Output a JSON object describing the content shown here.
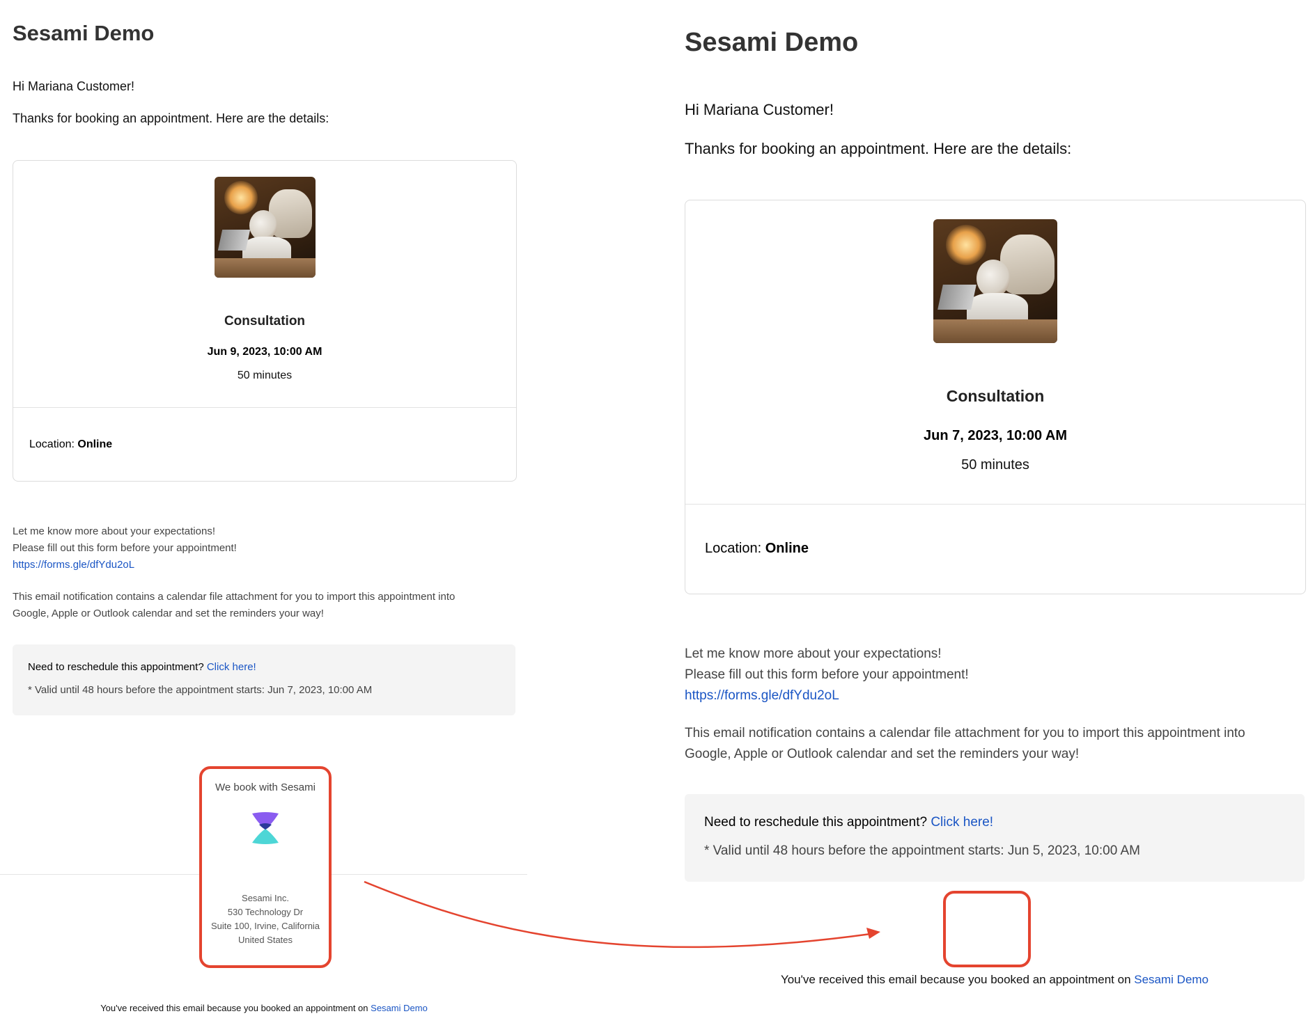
{
  "left": {
    "brand": "Sesami Demo",
    "greeting": "Hi Mariana Customer!",
    "intro": "Thanks for booking an appointment. Here are the details:",
    "service": "Consultation",
    "datetime": "Jun 9, 2023, 10:00 AM",
    "duration": "50 minutes",
    "location_label": "Location:",
    "location_value": "Online",
    "note_line1": "Let me know more about your expectations!",
    "note_line2": "Please fill out this form before your appointment!",
    "form_link": "https://forms.gle/dfYdu2oL",
    "calendar_line1": "This email notification contains a calendar file attachment for you to import this appointment into",
    "calendar_line2": "Google, Apple or Outlook calendar and set the reminders your way!",
    "reschedule_question": "Need to reschedule this appointment?",
    "reschedule_link": "Click here!",
    "reschedule_valid": "* Valid until 48 hours before the appointment starts: Jun 7, 2023, 10:00 AM",
    "badge_text": "We book with Sesami",
    "address": [
      "Sesami Inc.",
      "530 Technology Dr",
      "Suite 100, Irvine, California",
      "United States"
    ],
    "footer_text": "You've received this email because you booked an appointment on",
    "footer_link": "Sesami Demo"
  },
  "right": {
    "brand": "Sesami Demo",
    "greeting": "Hi Mariana Customer!",
    "intro": "Thanks for booking an appointment. Here are the details:",
    "service": "Consultation",
    "datetime": "Jun 7, 2023, 10:00 AM",
    "duration": "50 minutes",
    "location_label": "Location:",
    "location_value": "Online",
    "note_line1": "Let me know more about your expectations!",
    "note_line2": "Please fill out this form before your appointment!",
    "form_link": "https://forms.gle/dfYdu2oL",
    "calendar_line1": "This email notification contains a calendar file attachment for you to import this appointment into",
    "calendar_line2": "Google, Apple or Outlook calendar and set the reminders your way!",
    "reschedule_question": "Need to reschedule this appointment?",
    "reschedule_link": "Click here!",
    "reschedule_valid": "* Valid until 48 hours before the appointment starts: Jun 5, 2023, 10:00 AM",
    "footer_text": "You've received this email because you booked an appointment on",
    "footer_link": "Sesami Demo"
  },
  "colors": {
    "highlight": "#e4442f",
    "link": "#1a55c4",
    "logo_top": "#8a5cf0",
    "logo_bottom": "#4dd6d6"
  },
  "icons": {
    "logo": "sesami-hourglass-logo",
    "arrow": "curved-arrow"
  }
}
